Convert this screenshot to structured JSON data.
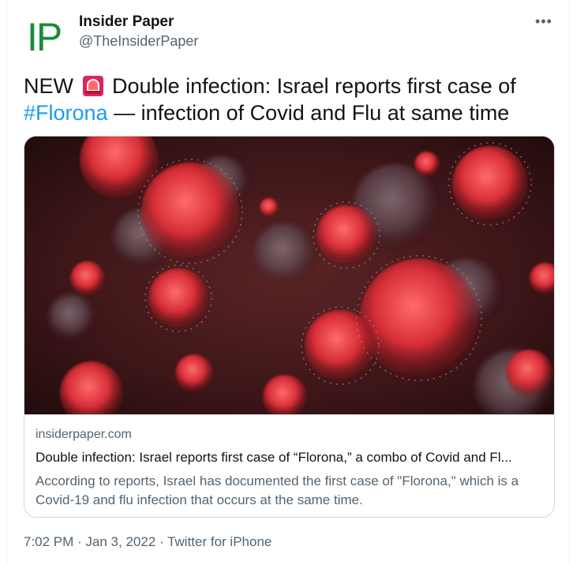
{
  "author": {
    "name": "Insider Paper",
    "handle": "@TheInsiderPaper",
    "avatar_text": "IP"
  },
  "tweet": {
    "prefix": "NEW",
    "siren_icon": "police-light-icon",
    "line1": "Double infection: Israel reports first case of",
    "hashtag": "#Florona",
    "line2": "— infection of Covid and Flu at same time"
  },
  "link_card": {
    "domain": "insiderpaper.com",
    "title": "Double infection: Israel reports first case of “Florona,” a combo of Covid and Fl...",
    "description": "According to reports, Israel has documented the first case of \"Florona,\" which is a Covid-19 and flu infection that occurs at the same time."
  },
  "meta": {
    "time": "7:02 PM · Jan 3, 2022 · Twitter for iPhone"
  },
  "colors": {
    "accent": "#1d9bf0",
    "secondary_text": "#536471",
    "brand_green": "#1a8c3a"
  }
}
